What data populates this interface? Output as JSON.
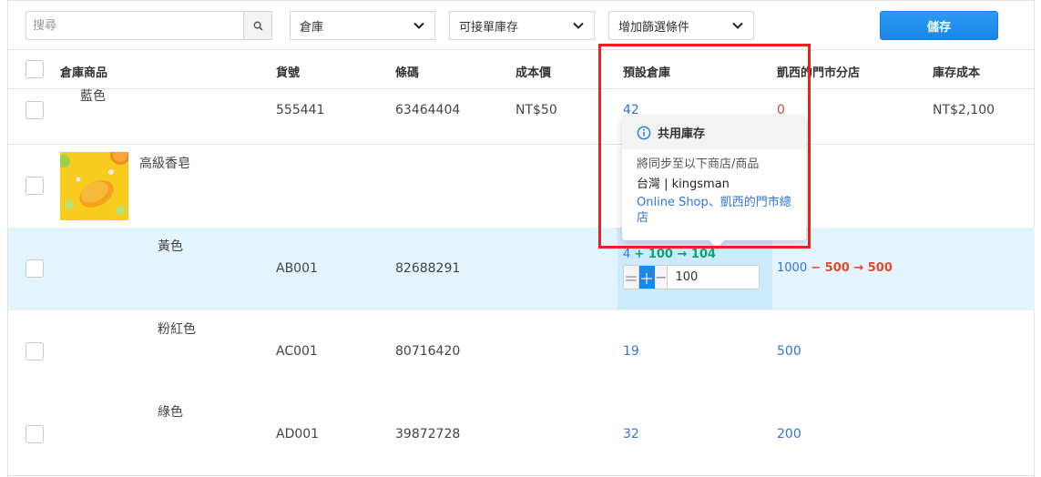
{
  "toolbar": {
    "search_placeholder": "搜尋",
    "warehouse_filter": "倉庫",
    "stock_filter": "可接單庫存",
    "add_filter": "增加篩選條件",
    "save_label": "儲存"
  },
  "table": {
    "headers": {
      "product": "倉庫商品",
      "sku": "貨號",
      "barcode": "條碼",
      "cost": "成本價",
      "default_warehouse": "預設倉庫",
      "branch": "凱西的門市分店",
      "stock_cost": "庫存成本"
    },
    "rows": [
      {
        "variant": "藍色",
        "sku": "555441",
        "barcode": "63464404",
        "cost": "NT$50",
        "default_stock": "42",
        "branch_stock": "0",
        "stock_cost": "NT$2,100"
      },
      {
        "product_name": "高級香皂"
      },
      {
        "variant": "黃色",
        "sku": "AB001",
        "barcode": "82688291",
        "default_stock": "4",
        "change_op": "+ 100 → 104",
        "branch_stock": "1000",
        "branch_change": "− 500 → 500",
        "stepper_value": "100"
      },
      {
        "variant": "粉紅色",
        "sku": "AC001",
        "barcode": "80716420",
        "default_stock": "19",
        "branch_stock": "500"
      },
      {
        "variant": "綠色",
        "sku": "AD001",
        "barcode": "39872728",
        "default_stock": "32",
        "branch_stock": "200"
      }
    ]
  },
  "tooltip": {
    "title": "共用庫存",
    "desc": "將同步至以下商店/商品",
    "store": "台灣 | kingsman",
    "links": "Online Shop、凱西的門市總店"
  },
  "colors": {
    "accent": "#1f86e8",
    "link": "#3273dc",
    "highlight_row": "#e3f4fc",
    "annotation": "#e8221d"
  }
}
